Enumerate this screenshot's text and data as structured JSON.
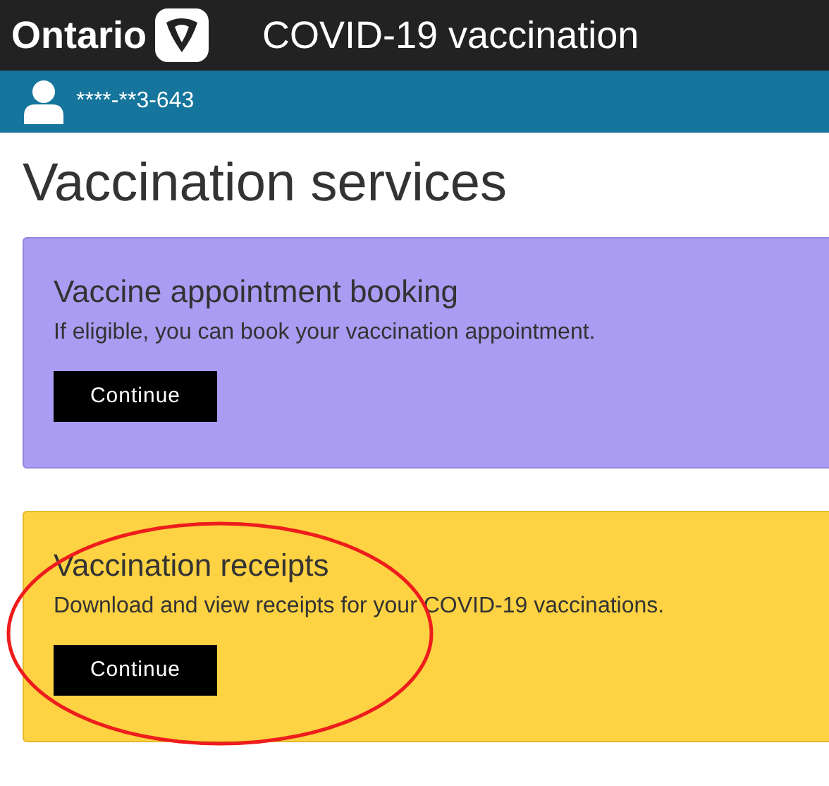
{
  "header": {
    "brand": "Ontario",
    "title": "COVID-19 vaccination"
  },
  "account_bar": {
    "masked_id": "****-**3-643"
  },
  "page_title": "Vaccination services",
  "cards": [
    {
      "kind": "purple",
      "title": "Vaccine appointment booking",
      "description": "If eligible, you can book your vaccination appointment.",
      "button": "Continue"
    },
    {
      "kind": "yellow",
      "title": "Vaccination receipts",
      "description": "Download and view receipts for your COVID-19 vaccinations.",
      "button": "Continue"
    }
  ],
  "annotations": [
    {
      "kind": "ellipse"
    }
  ]
}
